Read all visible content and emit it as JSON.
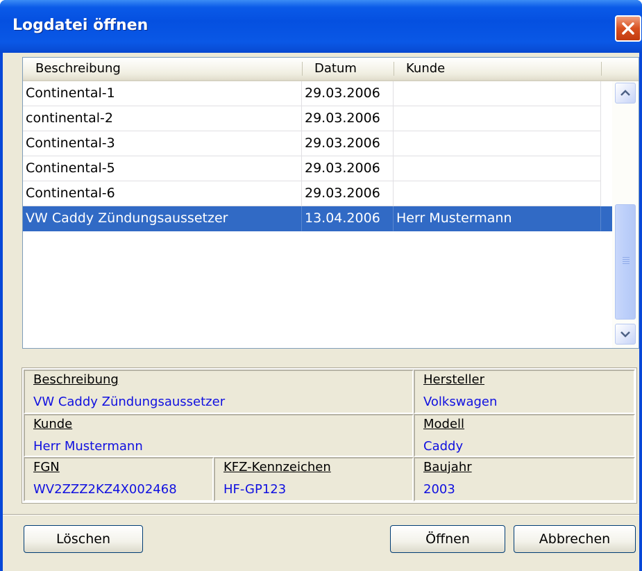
{
  "window": {
    "title": "Logdatei öffnen"
  },
  "list": {
    "columns": [
      "Beschreibung",
      "Datum",
      "Kunde"
    ],
    "rows": [
      {
        "beschreibung": "Continental-1",
        "datum": "29.03.2006",
        "kunde": ""
      },
      {
        "beschreibung": "continental-2",
        "datum": "29.03.2006",
        "kunde": ""
      },
      {
        "beschreibung": "Continental-3",
        "datum": "29.03.2006",
        "kunde": ""
      },
      {
        "beschreibung": "Continental-5",
        "datum": "29.03.2006",
        "kunde": ""
      },
      {
        "beschreibung": "Continental-6",
        "datum": "29.03.2006",
        "kunde": ""
      },
      {
        "beschreibung": "VW Caddy Zündungsaussetzer",
        "datum": "13.04.2006",
        "kunde": "Herr Mustermann"
      }
    ],
    "selected_index": 5
  },
  "details": {
    "beschreibung": {
      "label": "Beschreibung",
      "value": "VW Caddy Zündungsaussetzer"
    },
    "hersteller": {
      "label": "Hersteller",
      "value": "Volkswagen"
    },
    "kunde": {
      "label": "Kunde",
      "value": "Herr Mustermann"
    },
    "modell": {
      "label": "Modell",
      "value": "Caddy"
    },
    "fgn": {
      "label": "FGN",
      "value": "WV2ZZZ2KZ4X002468"
    },
    "kfz": {
      "label": "KFZ-Kennzeichen",
      "value": "HF-GP123"
    },
    "baujahr": {
      "label": "Baujahr",
      "value": "2003"
    }
  },
  "buttons": {
    "loeschen": "Löschen",
    "oeffnen": "Öffnen",
    "abbrechen": "Abbrechen"
  },
  "colors": {
    "titlebar": "#0a58e6",
    "selection": "#316ac5",
    "value_text": "#1010e0",
    "dialog_bg": "#ece9d8"
  }
}
